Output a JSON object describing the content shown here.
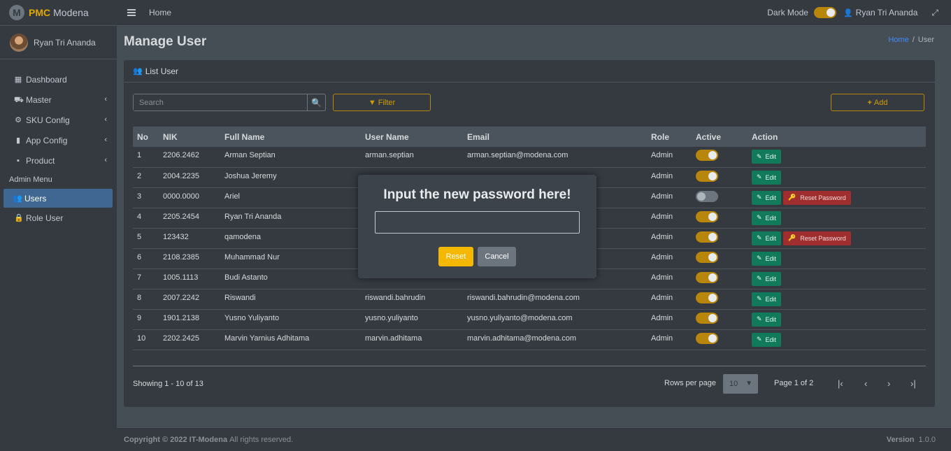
{
  "brand": {
    "short": "PMC",
    "name": "Modena",
    "logo_letter": "M"
  },
  "user": {
    "name": "Ryan Tri Ananda"
  },
  "sidebar": {
    "items": [
      {
        "label": "Dashboard",
        "icon": "th-icon",
        "glyph": "▦"
      },
      {
        "label": "Master",
        "icon": "car-icon",
        "glyph": "⛟",
        "chevron": "‹"
      },
      {
        "label": "SKU Config",
        "icon": "cog-icon",
        "glyph": "⚙",
        "chevron": "‹"
      },
      {
        "label": "App Config",
        "icon": "mobile-icon",
        "glyph": "▮",
        "chevron": "‹"
      },
      {
        "label": "Product",
        "icon": "briefcase-icon",
        "glyph": "▪",
        "chevron": "‹"
      }
    ],
    "header": "Admin Menu",
    "admin_items": [
      {
        "label": "Users",
        "icon": "users-icon",
        "glyph": "👥"
      },
      {
        "label": "Role User",
        "icon": "lock-icon",
        "glyph": "🔒"
      }
    ]
  },
  "navbar": {
    "home": "Home",
    "dark_mode_label": "Dark Mode",
    "user_glyph": "👤",
    "expand_glyph": "⤢"
  },
  "page": {
    "title": "Manage User",
    "breadcrumb_home": "Home",
    "breadcrumb_sep": "/",
    "breadcrumb_current": "User"
  },
  "card": {
    "header": "List User",
    "header_glyph": "👥"
  },
  "search": {
    "placeholder": "Search",
    "glyph": "🔍"
  },
  "filter": {
    "label": "Filter",
    "glyph": "▼"
  },
  "add": {
    "label": "Add",
    "glyph": "+"
  },
  "table": {
    "headers": [
      "No",
      "NIK",
      "Full Name",
      "User Name",
      "Email",
      "Role",
      "Active",
      "Action"
    ],
    "edit_label": "Edit",
    "edit_glyph": "✎",
    "reset_label": "Reset Password",
    "reset_glyph": "🔑",
    "rows": [
      {
        "no": "1",
        "nik": "2206.2462",
        "name": "Arman Septian",
        "username": "arman.septian",
        "email": "arman.septian@modena.com",
        "role": "Admin",
        "active": true,
        "reset": false
      },
      {
        "no": "2",
        "nik": "2004.2235",
        "name": "Joshua Jeremy",
        "username": "",
        "email": "",
        "role": "Admin",
        "active": true,
        "reset": false
      },
      {
        "no": "3",
        "nik": "0000.0000",
        "name": "Ariel",
        "username": "",
        "email": "",
        "role": "Admin",
        "active": false,
        "reset": true
      },
      {
        "no": "4",
        "nik": "2205.2454",
        "name": "Ryan Tri Ananda",
        "username": "",
        "email": "",
        "role": "Admin",
        "active": true,
        "reset": false
      },
      {
        "no": "5",
        "nik": "123432",
        "name": "qamodena",
        "username": "",
        "email": "",
        "role": "Admin",
        "active": true,
        "reset": true
      },
      {
        "no": "6",
        "nik": "2108.2385",
        "name": "Muhammad Nur",
        "username": "",
        "email": "",
        "role": "Admin",
        "active": true,
        "reset": false
      },
      {
        "no": "7",
        "nik": "1005.1113",
        "name": "Budi Astanto",
        "username": "",
        "email": "",
        "role": "Admin",
        "active": true,
        "reset": false
      },
      {
        "no": "8",
        "nik": "2007.2242",
        "name": "Riswandi",
        "username": "riswandi.bahrudin",
        "email": "riswandi.bahrudin@modena.com",
        "role": "Admin",
        "active": true,
        "reset": false
      },
      {
        "no": "9",
        "nik": "1901.2138",
        "name": "Yusno Yuliyanto",
        "username": "yusno.yuliyanto",
        "email": "yusno.yuliyanto@modena.com",
        "role": "Admin",
        "active": true,
        "reset": false
      },
      {
        "no": "10",
        "nik": "2202.2425",
        "name": "Marvin Yarnius Adhitama",
        "username": "marvin.adhitama",
        "email": "marvin.adhitama@modena.com",
        "role": "Admin",
        "active": true,
        "reset": false
      }
    ]
  },
  "pagination": {
    "showing": "Showing 1 - 10 of 13",
    "rows_per_page_label": "Rows per page",
    "rows_per_page_value": "10",
    "page_info": "Page 1 of 2",
    "first_glyph": "|‹",
    "prev_glyph": "‹",
    "next_glyph": "›",
    "last_glyph": "›|"
  },
  "footer": {
    "copyright": "Copyright © 2022 IT-Modena",
    "rights": "All rights reserved.",
    "version_label": "Version",
    "version_value": "1.0.0"
  },
  "modal": {
    "title": "Input the new password here!",
    "input_value": "",
    "reset_label": "Reset",
    "cancel_label": "Cancel"
  }
}
